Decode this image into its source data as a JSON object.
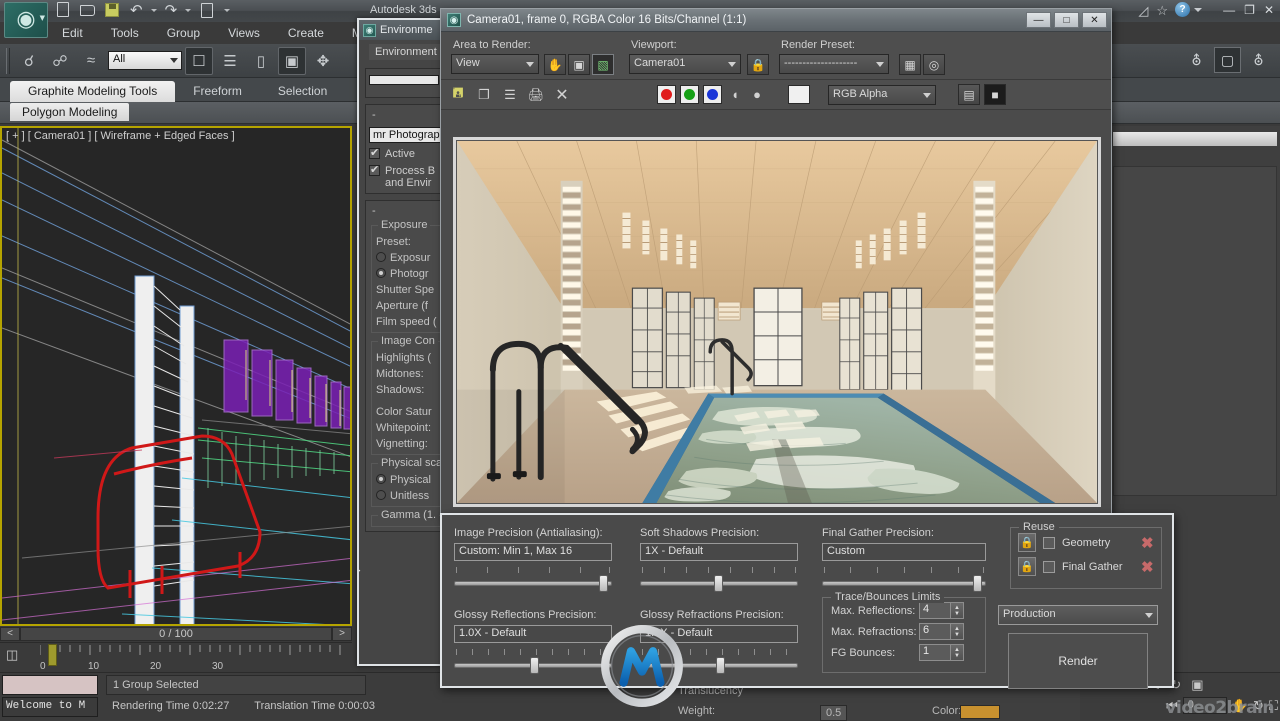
{
  "app": {
    "title": "Autodesk 3ds",
    "logo_glyph": "ͧ",
    "menus": [
      "Edit",
      "Tools",
      "Group",
      "Views",
      "Create",
      "Modifi"
    ],
    "window_buttons": {
      "minimize": "—",
      "restore": "❐",
      "close": "✕"
    },
    "help_label": "?",
    "quick_access": [
      "new-icon",
      "open-icon",
      "save-icon",
      "undo-icon",
      "redo-icon",
      "setproject-icon"
    ]
  },
  "toolbar": {
    "selection_filter": "All",
    "icons": [
      "link-icon",
      "unlink-icon",
      "bind-space-warp-icon",
      "select-object-icon",
      "select-by-name-icon",
      "rect-select-region-icon",
      "window-crossing-icon",
      "select-and-move-icon"
    ]
  },
  "ribbon": {
    "tabs": [
      {
        "label": "Graphite Modeling Tools",
        "active": true
      },
      {
        "label": "Freeform",
        "active": false
      },
      {
        "label": "Selection",
        "active": false
      }
    ],
    "panel": "Polygon Modeling"
  },
  "viewport": {
    "label": "[ + ] [ Camera01 ] [ Wireframe + Edged Faces ]"
  },
  "timeline": {
    "prev_label": "<",
    "frame_display": "0 / 100",
    "next_label": ">",
    "ticks": [
      "0",
      "10",
      "20",
      "30"
    ]
  },
  "statusbar": {
    "maxscript_prompt": "Welcome to M",
    "selection_status": "1 Group Selected",
    "rendering_time_label": "Rendering Time  0:02:27",
    "translation_time_label": "Translation Time  0:00:03",
    "frame_value": "0",
    "watermark": "video2brain"
  },
  "environment_dialog": {
    "title": "Environme",
    "tab": "Environment",
    "exposure_rollout": {
      "control_name": "mr Photograp",
      "active_label": "Active",
      "active_checked": true,
      "process_label_line1": "Process B",
      "process_label_line2": "and Envir",
      "process_checked": true
    },
    "exposure_group": {
      "title": "Exposure",
      "preset_label": "Preset:",
      "radio_exposure": "Exposur",
      "radio_photographic": "Photogr",
      "radio_selected": "photographic",
      "shutter_label": "Shutter Spe",
      "aperture_label": "Aperture (f",
      "film_speed_label": "Film speed ("
    },
    "image_control_group": {
      "title": "Image Con",
      "highlights_label": "Highlights (",
      "midtones_label": "Midtones:",
      "shadows_label": "Shadows:",
      "color_saturation_label": "Color Satur",
      "whitepoint_label": "Whitepoint:",
      "vignetting_label": "Vignetting:"
    },
    "physical_scale_group": {
      "title": "Physical sca",
      "radio_physical": "Physical",
      "radio_unitless": "Unitless",
      "radio_selected": "physical"
    },
    "gamma_group": {
      "title": "Gamma (1."
    }
  },
  "render_frame_window": {
    "title": "Camera01, frame 0, RGBA Color 16 Bits/Channel (1:1)",
    "window_buttons": {
      "minimize": "—",
      "maximize": "□",
      "close": "✕"
    },
    "area_to_render_label": "Area to Render:",
    "area_to_render_value": "View",
    "viewport_label": "Viewport:",
    "viewport_value": "Camera01",
    "render_preset_label": "Render Preset:",
    "render_preset_value": "--------------------",
    "channel_value": "RGB Alpha",
    "toolbar_icons": [
      "save-image-icon",
      "copy-image-icon",
      "clone-window-icon",
      "print-image-icon",
      "clear-image-icon"
    ],
    "channel_buttons": [
      "red-channel-icon",
      "green-channel-icon",
      "blue-channel-icon",
      "alpha-channel-icon",
      "mono-channel-icon"
    ],
    "channel_colors": {
      "red": "#e01b1b",
      "green": "#16a016",
      "blue": "#1a35d8"
    },
    "lock_icon": "lock-icon",
    "right_icons": [
      "render-setup-icon",
      "env-exposure-icon"
    ],
    "bottom_right_icons": [
      "enable-red-blue-icon",
      "display-alpha-icon"
    ],
    "rendered_image_alt": "Indoor swimming pool interior render with wood ceiling, windows with louvers, metal handrails and blue tiled pool"
  },
  "render_settings": {
    "image_precision": {
      "label": "Image Precision (Antialiasing):",
      "value": "Custom: Min 1, Max 16",
      "slider_pct": 96
    },
    "soft_shadows": {
      "label": "Soft Shadows Precision:",
      "value": "1X - Default",
      "slider_pct": 50
    },
    "final_gather": {
      "label": "Final Gather Precision:",
      "value": "Custom",
      "slider_pct": 96
    },
    "glossy_reflections": {
      "label": "Glossy Reflections Precision:",
      "value": "1.0X - Default",
      "slider_pct": 50
    },
    "glossy_refractions": {
      "label": "Glossy Refractions Precision:",
      "value": "1.0X - Default",
      "slider_pct": 50
    },
    "trace_bounces": {
      "title": "Trace/Bounces Limits",
      "rows": [
        {
          "label": "Max. Reflections:",
          "value": "4"
        },
        {
          "label": "Max. Refractions:",
          "value": "6"
        },
        {
          "label": "FG Bounces:",
          "value": "1"
        }
      ]
    },
    "reuse": {
      "title": "Reuse",
      "rows": [
        {
          "label": "Geometry",
          "checked": false
        },
        {
          "label": "Final Gather",
          "checked": false
        }
      ]
    },
    "preset_value": "Production",
    "render_button": "Render"
  },
  "background_material": {
    "translucency_label": "Translucency",
    "weight_label": "Weight:",
    "weight_value": "0.5",
    "color_label": "Color:",
    "color_swatch": "#c8912f"
  },
  "colors": {
    "window_bg": "#3a3a3a",
    "dialog_bg": "#4a4a4a",
    "accent_border": "#e0e4e7",
    "viewport_border": "#b5a400",
    "logo_teal": "#2d6e66"
  }
}
